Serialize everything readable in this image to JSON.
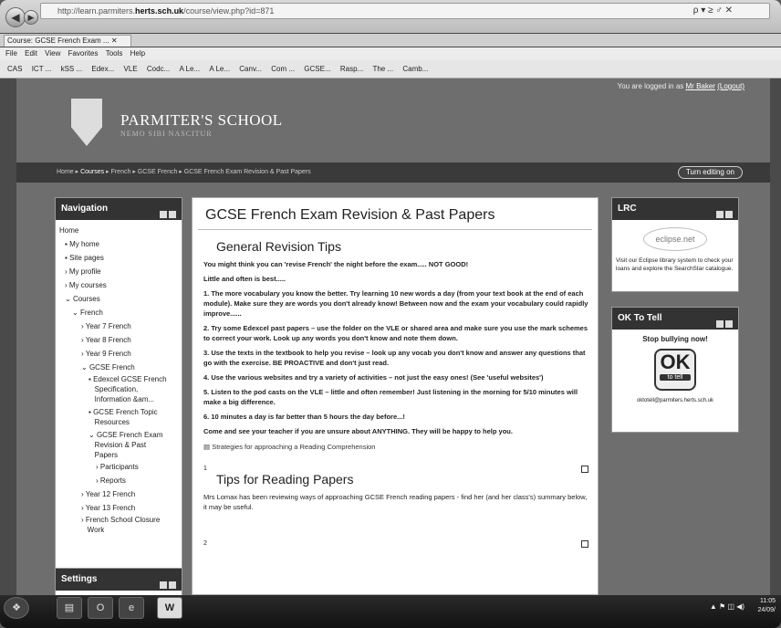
{
  "browser": {
    "url_prefix": "http://learn.parmiters.",
    "url_domain": "herts.sch.uk",
    "url_path": "/course/view.php?id=871",
    "url_controls": "ρ ▾ ≥ ♂ ✕",
    "tab_title": "Course: GCSE French Exam ...",
    "menus": [
      "File",
      "Edit",
      "View",
      "Favorites",
      "Tools",
      "Help"
    ],
    "favorites": [
      "CAS",
      "ICT ...",
      "kSS ...",
      "Edex...",
      "VLE",
      "Codc...",
      "A Le...",
      "A Le...",
      "Canv...",
      "Com ...",
      "GCSE...",
      "Rasp...",
      "The ...",
      "Camb..."
    ]
  },
  "header": {
    "login_text": "You are logged in as",
    "login_user": "Mr Baker",
    "logout": "(Logout)",
    "school_name": "PARMITER'S SCHOOL",
    "motto": "NEMO SIBI NASCITUR"
  },
  "breadcrumb": {
    "items": [
      "Home",
      "Courses",
      "French",
      "GCSE French",
      "GCSE French Exam Revision & Past Papers"
    ],
    "editing_button": "Turn editing on"
  },
  "navigation": {
    "title": "Navigation",
    "items": [
      "Home",
      "My home",
      "Site pages",
      "My profile",
      "My courses",
      "Courses",
      "French",
      "Year 7 French",
      "Year 8 French",
      "Year 9 French",
      "GCSE French",
      "Edexcel GCSE French",
      "Specification,",
      "Information &am...",
      "GCSE French Topic",
      "Resources",
      "GCSE French Exam",
      "Revision & Past",
      "Papers",
      "Participants",
      "Reports",
      "Year 12 French",
      "Year 13 French",
      "French School Closure",
      "Work"
    ]
  },
  "settings": {
    "title": "Settings"
  },
  "main": {
    "page_title": "GCSE French Exam Revision & Past Papers",
    "section_title": "General Revision Tips",
    "paragraphs": [
      "You might think you can 'revise French' the night before the exam..... NOT GOOD!",
      "Little and often is best.....",
      "1.  The more vocabulary you know the better. Try learning 10 new words a day (from your text book at the end of each module). Make sure they are words you don't already know!  Between now and the exam your vocabulary could rapidly improve......",
      "2.  Try some Edexcel past papers – use the folder on the VLE or shared area and make sure you use the mark schemes to correct your work. Look up any words you don't know and note them down.",
      "3.  Use the texts in the textbook to help you revise – look up any vocab you don't know and answer any questions that go with the exercise. BE PROACTIVE and don't just read.",
      "4.  Use the various websites and try a variety of activities – not just the easy ones! (See 'useful websites')",
      "5.  Listen to the pod casts on the VLE – little and often remember!  Just listening in the morning for 5/10 minutes will make a big difference.",
      "6.  10 minutes a day is far better than 5 hours the day before...!",
      "Come and see your teacher if you are unsure about ANYTHING. They will be happy to help you."
    ],
    "resource_link": "Strategies for approaching a Reading Comprehension",
    "section1_number": "1",
    "section1_title": "Tips for Reading Papers",
    "section1_text": "Mrs Lomax has been reviewing ways of approaching GCSE French reading papers - find her (and her class's) summary below, it may be useful.",
    "section2_number": "2"
  },
  "lrc": {
    "title": "LRC",
    "logo_text": "eclipse.net",
    "text": "Visit our Eclipse library system to check your loans and explore the SearchStar catalogue."
  },
  "oktotell": {
    "title": "OK To Tell",
    "slogan": "Stop bullying now!",
    "logo_big": "OK",
    "logo_small": "to tell",
    "email": "oktotell@parmiters.herts.sch.uk"
  },
  "taskbar": {
    "tray": "▲ ⚑ ◫ ◀)",
    "time": "11:05",
    "date": "24/09/"
  }
}
